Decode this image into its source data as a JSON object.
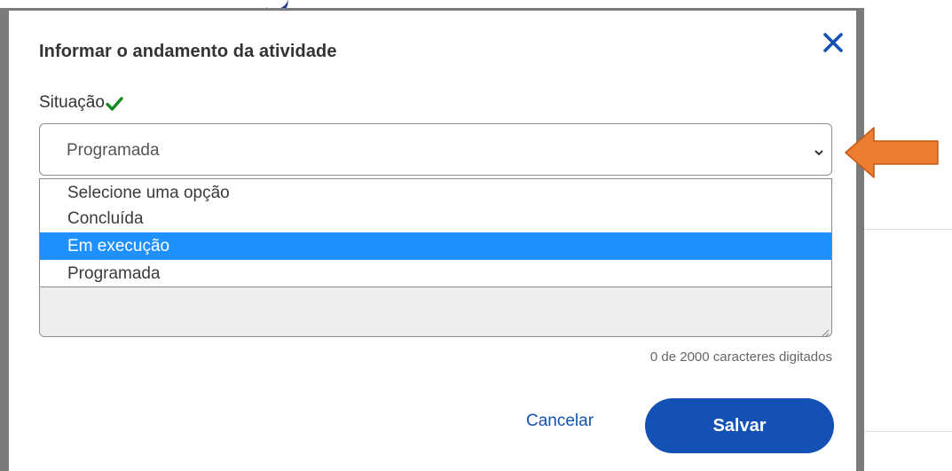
{
  "modal": {
    "title": "Informar o andamento da atividade",
    "close_icon": "close-icon"
  },
  "situacao": {
    "label": "Situação",
    "status_icon": "check-icon",
    "selected_value": "Programada",
    "options": [
      "Selecione uma opção",
      "Concluída",
      "Em execução",
      "Programada"
    ],
    "highlighted_index": 2
  },
  "description": {
    "value": "",
    "char_counter": "0 de 2000 caracteres digitados"
  },
  "actions": {
    "cancel_label": "Cancelar",
    "save_label": "Salvar"
  },
  "colors": {
    "primary": "#1351b4",
    "highlight": "#1e90ff",
    "check": "#168821",
    "annotation_arrow": "#ed7d31"
  },
  "annotation": {
    "icon": "arrow-left-icon"
  }
}
